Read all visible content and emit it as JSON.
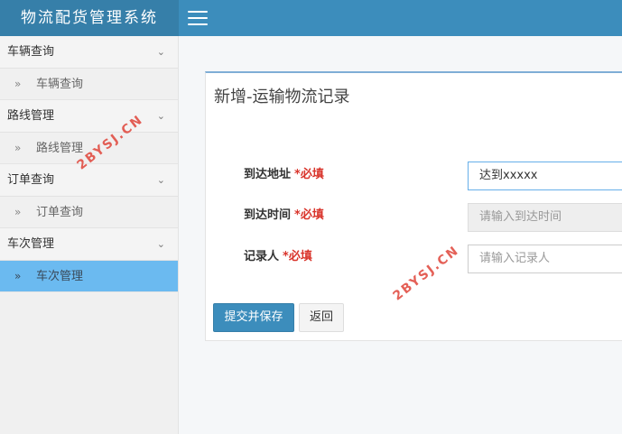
{
  "app": {
    "title": "物流配货管理系统"
  },
  "sidebar": {
    "groups": [
      {
        "label": "车辆查询",
        "items": [
          {
            "label": "车辆查询"
          }
        ]
      },
      {
        "label": "路线管理",
        "items": [
          {
            "label": "路线管理"
          }
        ]
      },
      {
        "label": "订单查询",
        "items": [
          {
            "label": "订单查询"
          }
        ]
      },
      {
        "label": "车次管理",
        "items": [
          {
            "label": "车次管理"
          }
        ]
      }
    ],
    "active_item": "车次管理"
  },
  "form": {
    "title": "新增-运输物流记录",
    "required_mark": "*必填",
    "fields": [
      {
        "label": "到达地址",
        "value": "达到xxxxx",
        "placeholder": ""
      },
      {
        "label": "到达时间",
        "value": "",
        "placeholder": "请输入到达时间"
      },
      {
        "label": "记录人",
        "value": "",
        "placeholder": "请输入记录人"
      }
    ],
    "submit_label": "提交并保存",
    "back_label": "返回"
  },
  "watermark": {
    "text": "2BYSJ.CN"
  },
  "colors": {
    "header": "#3c8dbc",
    "brand": "#367fa9",
    "active_item": "#6bbaf0",
    "required": "#d9342b"
  },
  "icons": {
    "menu_toggle": "hamburger-icon",
    "collapse": "chevron-down-icon",
    "item": "double-chevron-right-icon"
  }
}
